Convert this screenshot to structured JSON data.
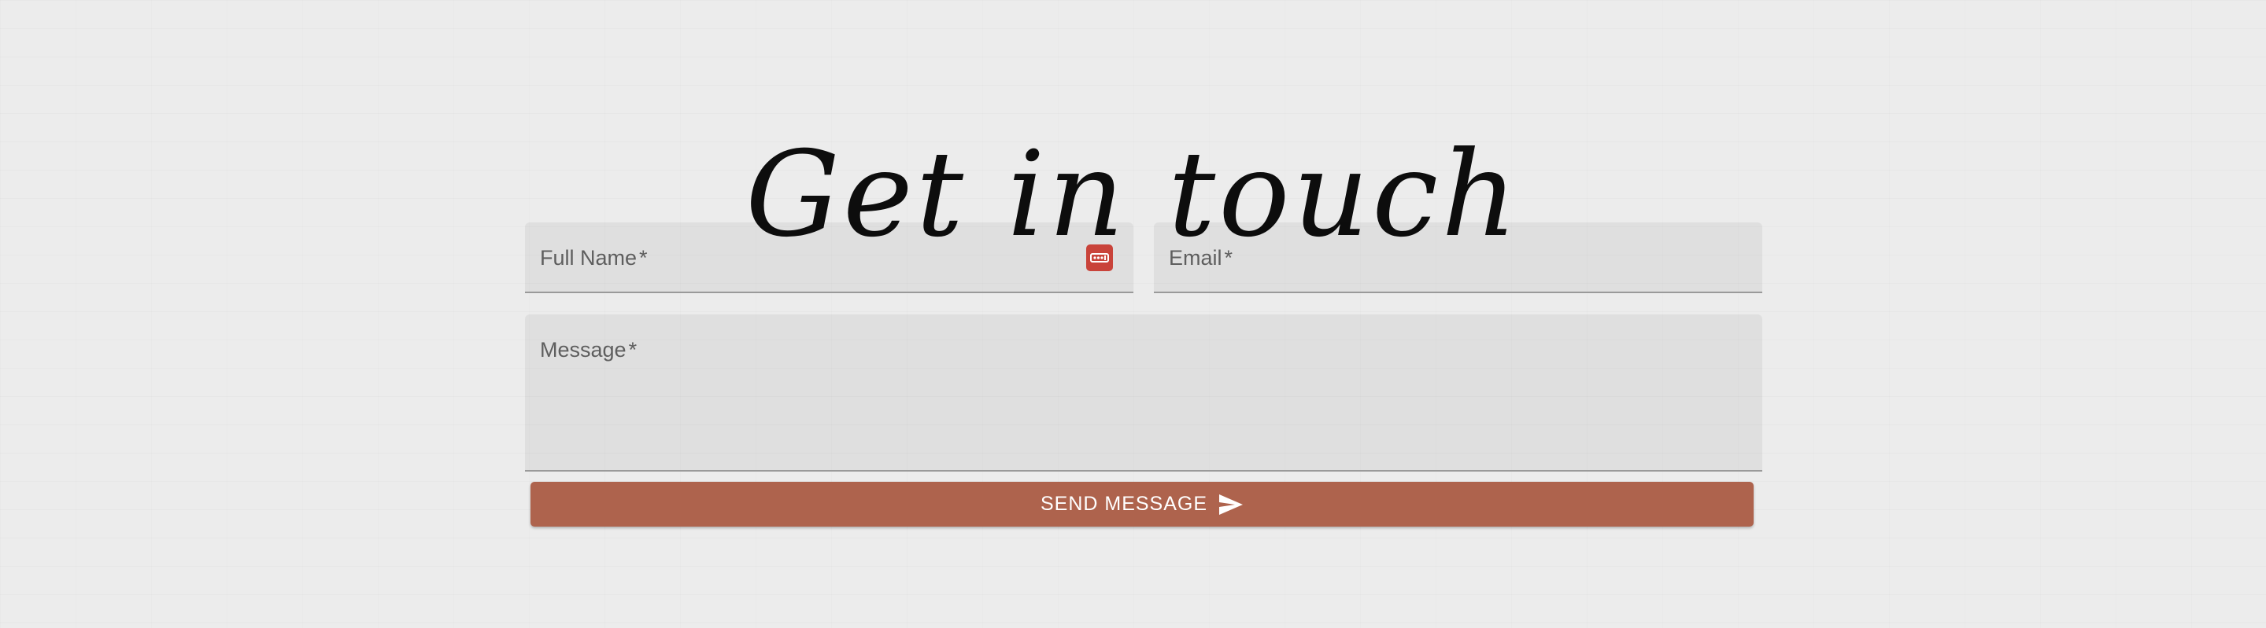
{
  "header": {
    "title": "Get in touch"
  },
  "form": {
    "full_name": {
      "label": "Full Name",
      "required_marker": "*",
      "value": "",
      "autofill_icon": "password-manager-icon"
    },
    "email": {
      "label": "Email",
      "required_marker": "*",
      "value": ""
    },
    "message": {
      "label": "Message",
      "required_marker": "*",
      "value": ""
    },
    "submit": {
      "label": "SEND MESSAGE",
      "icon": "send-icon"
    }
  },
  "colors": {
    "background": "#ececec",
    "field_fill": "#dedede",
    "button": "#ae634d",
    "autofill_icon": "#c9433a",
    "title_text": "#0d0d0d"
  }
}
